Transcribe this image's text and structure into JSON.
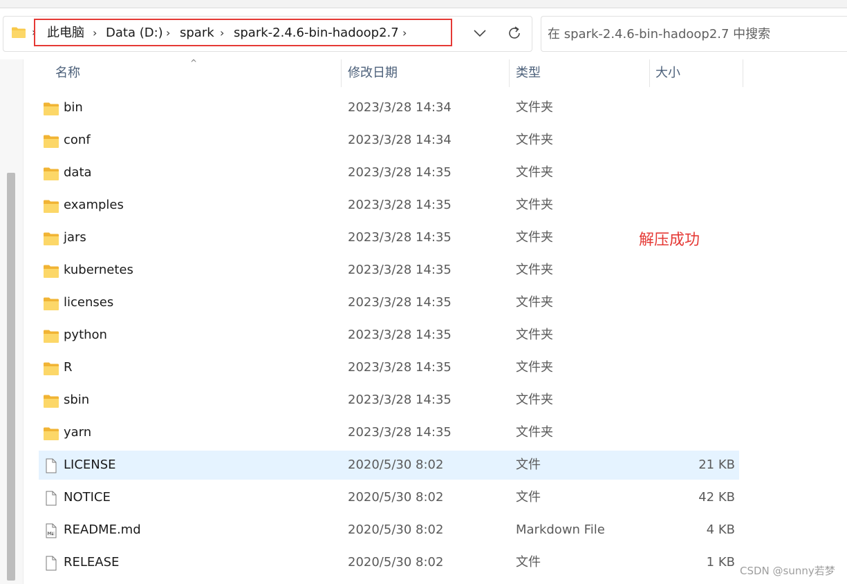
{
  "address_bar": {
    "breadcrumbs": [
      "此电脑",
      "Data (D:)",
      "spark",
      "spark-2.4.6-bin-hadoop2.7"
    ],
    "search_placeholder": "在 spark-2.4.6-bin-hadoop2.7 中搜索"
  },
  "columns": {
    "name": "名称",
    "date": "修改日期",
    "type": "类型",
    "size": "大小"
  },
  "files": [
    {
      "name": "bin",
      "date": "2023/3/28 14:34",
      "type": "文件夹",
      "size": "",
      "icon": "folder-icon"
    },
    {
      "name": "conf",
      "date": "2023/3/28 14:34",
      "type": "文件夹",
      "size": "",
      "icon": "folder-icon"
    },
    {
      "name": "data",
      "date": "2023/3/28 14:35",
      "type": "文件夹",
      "size": "",
      "icon": "folder-icon"
    },
    {
      "name": "examples",
      "date": "2023/3/28 14:35",
      "type": "文件夹",
      "size": "",
      "icon": "folder-icon"
    },
    {
      "name": "jars",
      "date": "2023/3/28 14:35",
      "type": "文件夹",
      "size": "",
      "icon": "folder-icon"
    },
    {
      "name": "kubernetes",
      "date": "2023/3/28 14:35",
      "type": "文件夹",
      "size": "",
      "icon": "folder-icon"
    },
    {
      "name": "licenses",
      "date": "2023/3/28 14:35",
      "type": "文件夹",
      "size": "",
      "icon": "folder-icon"
    },
    {
      "name": "python",
      "date": "2023/3/28 14:35",
      "type": "文件夹",
      "size": "",
      "icon": "folder-icon"
    },
    {
      "name": "R",
      "date": "2023/3/28 14:35",
      "type": "文件夹",
      "size": "",
      "icon": "folder-icon"
    },
    {
      "name": "sbin",
      "date": "2023/3/28 14:35",
      "type": "文件夹",
      "size": "",
      "icon": "folder-icon"
    },
    {
      "name": "yarn",
      "date": "2023/3/28 14:35",
      "type": "文件夹",
      "size": "",
      "icon": "folder-icon"
    },
    {
      "name": "LICENSE",
      "date": "2020/5/30 8:02",
      "type": "文件",
      "size": "21 KB",
      "icon": "file-icon",
      "selected": true
    },
    {
      "name": "NOTICE",
      "date": "2020/5/30 8:02",
      "type": "文件",
      "size": "42 KB",
      "icon": "file-icon"
    },
    {
      "name": "README.md",
      "date": "2020/5/30 8:02",
      "type": "Markdown File",
      "size": "4 KB",
      "icon": "markdown-file-icon"
    },
    {
      "name": "RELEASE",
      "date": "2020/5/30 8:02",
      "type": "文件",
      "size": "1 KB",
      "icon": "file-icon"
    }
  ],
  "annotation": "解压成功",
  "watermark": "CSDN @sunny若梦",
  "colors": {
    "annotation": "#e53935",
    "highlight_box": "#e53935",
    "folder": "#f8c94a",
    "selected_row": "#e5f3ff"
  }
}
